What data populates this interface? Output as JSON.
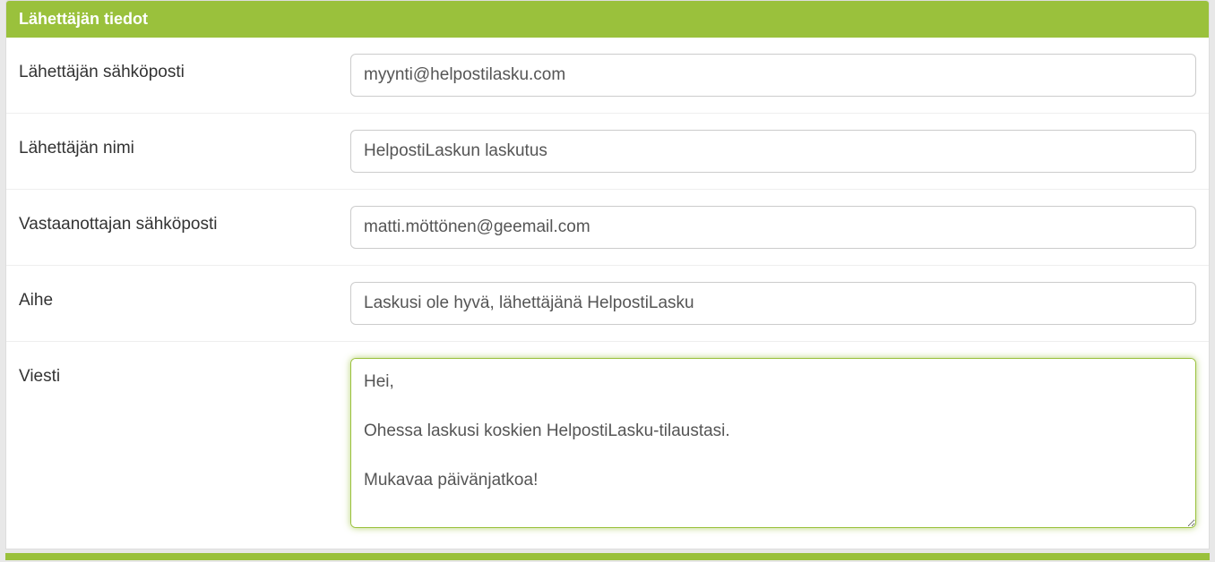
{
  "panel": {
    "title": "Lähettäjän tiedot"
  },
  "labels": {
    "sender_email": "Lähettäjän sähköposti",
    "sender_name": "Lähettäjän nimi",
    "recipient_email": "Vastaanottajan sähköposti",
    "subject": "Aihe",
    "message": "Viesti"
  },
  "values": {
    "sender_email": "myynti@helpostilasku.com",
    "sender_name": "HelpostiLaskun laskutus",
    "recipient_email": "matti.möttönen@geemail.com",
    "subject": "Laskusi ole hyvä, lähettäjänä HelpostiLasku",
    "message": "Hei,\n\nOhessa laskusi koskien HelpostiLasku-tilaustasi.\n\nMukavaa päivänjatkoa!\n"
  }
}
